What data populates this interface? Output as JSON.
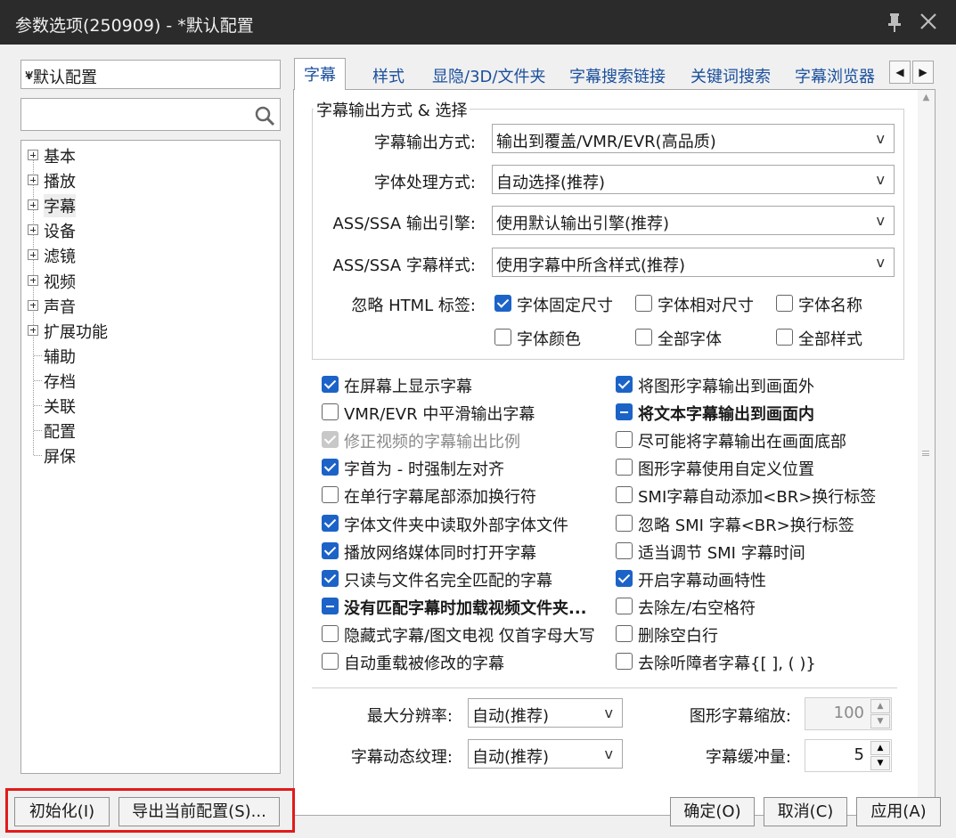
{
  "window": {
    "title": "参数选项(250909) - *默认配置",
    "pin_icon": "pin-icon",
    "close_icon": "close-icon"
  },
  "sidebar": {
    "profile": "*默认配置",
    "search_placeholder": "",
    "tree": [
      {
        "label": "基本",
        "expandable": true
      },
      {
        "label": "播放",
        "expandable": true
      },
      {
        "label": "字幕",
        "expandable": true,
        "selected": true
      },
      {
        "label": "设备",
        "expandable": true
      },
      {
        "label": "滤镜",
        "expandable": true
      },
      {
        "label": "视频",
        "expandable": true
      },
      {
        "label": "声音",
        "expandable": true
      },
      {
        "label": "扩展功能",
        "expandable": true
      },
      {
        "label": "辅助",
        "expandable": false
      },
      {
        "label": "存档",
        "expandable": false
      },
      {
        "label": "关联",
        "expandable": false
      },
      {
        "label": "配置",
        "expandable": false
      },
      {
        "label": "屏保",
        "expandable": false
      }
    ]
  },
  "tabs": [
    "字幕",
    "样式",
    "显隐/3D/文件夹",
    "字幕搜索链接",
    "关键词搜索",
    "字幕浏览器"
  ],
  "active_tab": "字幕",
  "output_group": {
    "title": "字幕输出方式 & 选择",
    "rows": [
      {
        "label": "字幕输出方式:",
        "value": "输出到覆盖/VMR/EVR(高品质)"
      },
      {
        "label": "字体处理方式:",
        "value": "自动选择(推荐)"
      },
      {
        "label": "ASS/SSA 输出引擎:",
        "value": "使用默认输出引擎(推荐)"
      },
      {
        "label": "ASS/SSA 字幕样式:",
        "value": "使用字幕中所含样式(推荐)"
      }
    ],
    "ignore_html_label": "忽略 HTML 标签:",
    "ignore_html": [
      {
        "label": "字体固定尺寸",
        "state": "checked"
      },
      {
        "label": "字体相对尺寸",
        "state": "unchecked"
      },
      {
        "label": "字体名称",
        "state": "unchecked"
      },
      {
        "label": "字体颜色",
        "state": "unchecked"
      },
      {
        "label": "全部字体",
        "state": "unchecked"
      },
      {
        "label": "全部样式",
        "state": "unchecked"
      }
    ]
  },
  "options_left": [
    {
      "label": "在屏幕上显示字幕",
      "state": "checked"
    },
    {
      "label": "VMR/EVR 中平滑输出字幕",
      "state": "unchecked"
    },
    {
      "label": "修正视频的字幕输出比例",
      "state": "disabled"
    },
    {
      "label": "字首为 - 时强制左对齐",
      "state": "checked"
    },
    {
      "label": "在单行字幕尾部添加换行符",
      "state": "unchecked"
    },
    {
      "label": "字体文件夹中读取外部字体文件",
      "state": "checked"
    },
    {
      "label": "播放网络媒体同时打开字幕",
      "state": "checked"
    },
    {
      "label": "只读与文件名完全匹配的字幕",
      "state": "checked"
    },
    {
      "label": "没有匹配字幕时加载视频文件夹...",
      "state": "indeterminate"
    },
    {
      "label": "隐藏式字幕/图文电视 仅首字母大写",
      "state": "unchecked"
    },
    {
      "label": "自动重载被修改的字幕",
      "state": "unchecked"
    }
  ],
  "options_right": [
    {
      "label": "将图形字幕输出到画面外",
      "state": "checked"
    },
    {
      "label": "将文本字幕输出到画面内",
      "state": "indeterminate"
    },
    {
      "label": "尽可能将字幕输出在画面底部",
      "state": "unchecked"
    },
    {
      "label": "图形字幕使用自定义位置",
      "state": "unchecked"
    },
    {
      "label": "SMI字幕自动添加<BR>换行标签",
      "state": "unchecked"
    },
    {
      "label": "忽略 SMI 字幕<BR>换行标签",
      "state": "unchecked"
    },
    {
      "label": "适当调节 SMI 字幕时间",
      "state": "unchecked"
    },
    {
      "label": "开启字幕动画特性",
      "state": "checked"
    },
    {
      "label": "去除左/右空格符",
      "state": "unchecked"
    },
    {
      "label": "删除空白行",
      "state": "unchecked"
    },
    {
      "label": "去除听障者字幕{[ ], ( )}",
      "state": "unchecked"
    }
  ],
  "bottom_fields": {
    "max_res_label": "最大分辨率:",
    "max_res_value": "自动(推荐)",
    "texture_label": "字幕动态纹理:",
    "texture_value": "自动(推荐)",
    "graphic_scale_label": "图形字幕缩放:",
    "graphic_scale_value": "100",
    "buffer_label": "字幕缓冲量:",
    "buffer_value": "5"
  },
  "footer": {
    "init": "初始化(I)",
    "export": "导出当前配置(S)...",
    "ok": "确定(O)",
    "cancel": "取消(C)",
    "apply": "应用(A)"
  },
  "highlight_color": "#e11b1b",
  "accent_color": "#1c63c7"
}
